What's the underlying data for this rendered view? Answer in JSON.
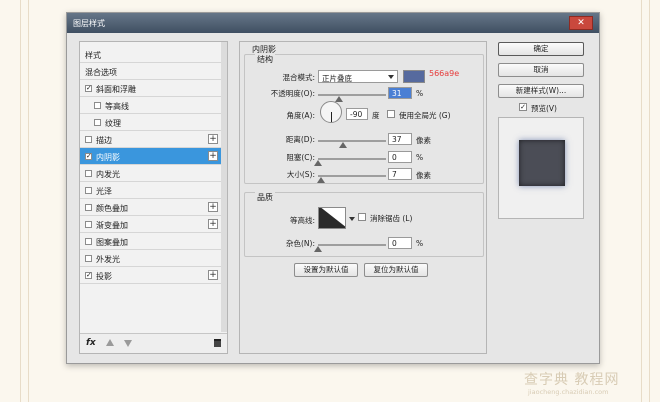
{
  "dialog": {
    "title": "图层样式",
    "close_glyph": "✕"
  },
  "style_list": {
    "items": [
      {
        "label": "样式",
        "checkbox": false,
        "checked": false,
        "plus": false,
        "active": false
      },
      {
        "label": "混合选项",
        "checkbox": false,
        "checked": false,
        "plus": false,
        "active": false
      },
      {
        "label": "斜面和浮雕",
        "checkbox": true,
        "checked": true,
        "plus": false,
        "active": false
      },
      {
        "label": "等高线",
        "checkbox": true,
        "checked": false,
        "plus": false,
        "active": false,
        "indent": true
      },
      {
        "label": "纹理",
        "checkbox": true,
        "checked": false,
        "plus": false,
        "active": false,
        "indent": true
      },
      {
        "label": "描边",
        "checkbox": true,
        "checked": false,
        "plus": true,
        "active": false
      },
      {
        "label": "内阴影",
        "checkbox": true,
        "checked": true,
        "plus": true,
        "active": true
      },
      {
        "label": "内发光",
        "checkbox": true,
        "checked": false,
        "plus": false,
        "active": false
      },
      {
        "label": "光泽",
        "checkbox": true,
        "checked": false,
        "plus": false,
        "active": false
      },
      {
        "label": "颜色叠加",
        "checkbox": true,
        "checked": false,
        "plus": true,
        "active": false
      },
      {
        "label": "渐变叠加",
        "checkbox": true,
        "checked": false,
        "plus": true,
        "active": false
      },
      {
        "label": "图案叠加",
        "checkbox": true,
        "checked": false,
        "plus": false,
        "active": false
      },
      {
        "label": "外发光",
        "checkbox": true,
        "checked": false,
        "plus": false,
        "active": false
      },
      {
        "label": "投影",
        "checkbox": true,
        "checked": true,
        "plus": true,
        "active": false
      }
    ],
    "footer": {
      "fx_label": "fx"
    }
  },
  "inner_shadow": {
    "title": "内阴影",
    "structure": {
      "title": "结构",
      "blend_mode_label": "混合模式:",
      "blend_mode_value": "正片叠底",
      "color_hex": "#566a9e",
      "color_label": "566a9e",
      "opacity_label": "不透明度(O):",
      "opacity_value": "31",
      "opacity_unit": "%",
      "opacity_level": 0.31,
      "angle_label": "角度(A):",
      "angle_value": "-90",
      "angle_unit": "度",
      "global_light_label": "使用全局光 (G)",
      "global_light_checked": false,
      "distance_label": "距离(D):",
      "distance_value": "37",
      "distance_unit": "像素",
      "distance_level": 0.37,
      "choke_label": "阻塞(C):",
      "choke_value": "0",
      "choke_unit": "%",
      "choke_level": 0,
      "size_label": "大小(S):",
      "size_value": "7",
      "size_unit": "像素",
      "size_level": 0.05
    },
    "quality": {
      "title": "品质",
      "contour_label": "等高线:",
      "anti_alias_label": "消除锯齿 (L)",
      "anti_alias_checked": false,
      "noise_label": "杂色(N):",
      "noise_value": "0",
      "noise_unit": "%",
      "noise_level": 0
    },
    "buttons": {
      "make_default": "设置为默认值",
      "reset_default": "复位为默认值"
    }
  },
  "actions": {
    "ok": "确定",
    "cancel": "取消",
    "new_style": "新建样式(W)...",
    "preview_label": "预览(V)",
    "preview_checked": true
  },
  "watermark": {
    "line1": "查字典 教程网",
    "line2": "jiaocheng.chazidian.com"
  }
}
